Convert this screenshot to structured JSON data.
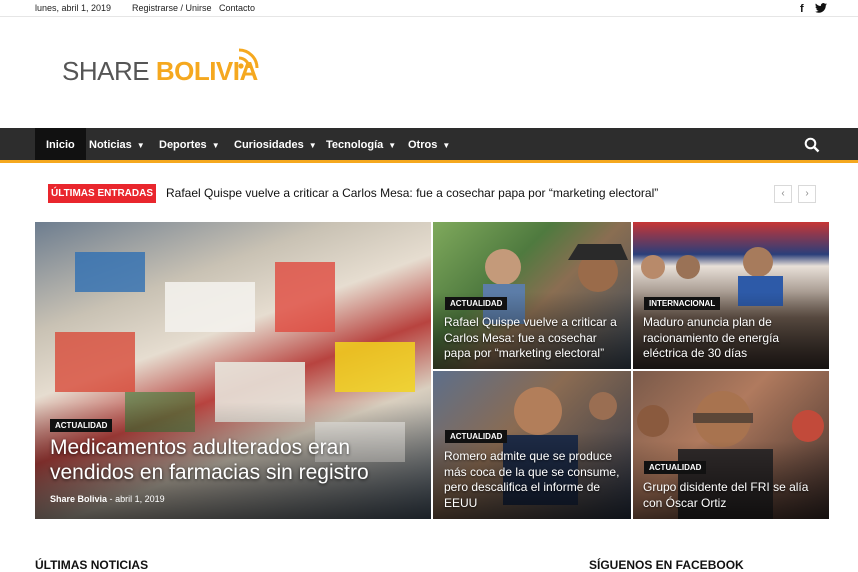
{
  "topbar": {
    "date": "lunes, abril 1, 2019",
    "register": "Registrarse / Unirse",
    "contact": "Contacto",
    "social_facebook": "f",
    "social_twitter": "twitter-icon"
  },
  "logo": {
    "part1": "SHARE ",
    "part2": "BOLIVIA"
  },
  "nav": {
    "items": [
      {
        "label": "Inicio"
      },
      {
        "label": "Noticias"
      },
      {
        "label": "Deportes"
      },
      {
        "label": "Curiosidades"
      },
      {
        "label": "Tecnología"
      },
      {
        "label": "Otros"
      }
    ]
  },
  "ticker": {
    "label": "ÚLTIMAS ENTRADAS",
    "text": "Rafael Quispe vuelve a criticar a Carlos Mesa: fue a cosechar papa por “marketing electoral”",
    "prev": "‹",
    "next": "›"
  },
  "featured": {
    "main": {
      "tag": "Actualidad",
      "title": "Medicamentos adulterados eran vendidos en farmacias sin registro",
      "author": "Share Bolivia",
      "separator": "-",
      "date": "abril 1, 2019"
    },
    "tiles": [
      {
        "tag": "Actualidad",
        "title": "Rafael Quispe vuelve a criticar a Carlos Mesa: fue a cosechar papa por “marketing electoral”"
      },
      {
        "tag": "Internacional",
        "title": "Maduro anuncia plan de racionamiento de energía eléctrica de 30 días"
      },
      {
        "tag": "Actualidad",
        "title": "Romero admite que se produce más coca de la que se consume, pero descalifica el informe de EEUU"
      },
      {
        "tag": "Actualidad",
        "title": "Grupo disidente del FRI se alía con Óscar Ortiz"
      }
    ]
  },
  "sections": {
    "latest": "ÚLTIMAS NOTICIAS",
    "facebook": "SÍGUENOS EN FACEBOOK"
  },
  "colors": {
    "accent": "#f5a81f",
    "ticker_red": "#e9262d",
    "nav_bg": "#2d2d2d"
  }
}
